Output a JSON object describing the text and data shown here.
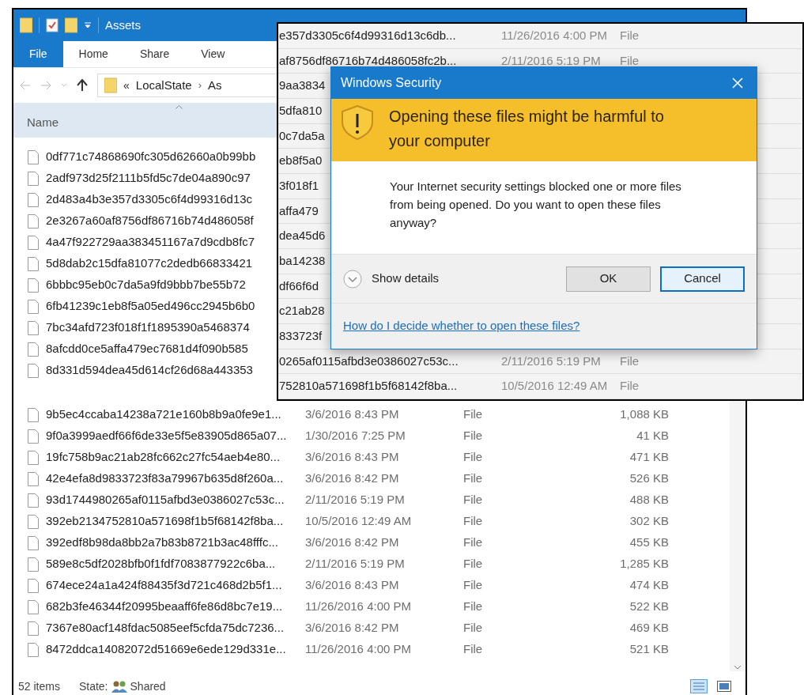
{
  "explorer": {
    "title": "Assets",
    "ribbon_tabs": [
      {
        "label": "File",
        "selected": true
      },
      {
        "label": "Home",
        "selected": false
      },
      {
        "label": "Share",
        "selected": false
      },
      {
        "label": "View",
        "selected": false
      }
    ],
    "breadcrumb": {
      "overflow": "«",
      "items": [
        "LocalState",
        "As"
      ],
      "separator": "›"
    },
    "column_header": "Name",
    "files": [
      {
        "name": "0df771c74868690fc305d62660a0b99bb"
      },
      {
        "name": "2adf973d25f2111b5fd5c7de04a890c97"
      },
      {
        "name": "2d483a4b3e357d3305c6f4d99316d13c"
      },
      {
        "name": "2e3267a60af8756df86716b74d486058f"
      },
      {
        "name": "4a47f922729aa383451167a7d9cdb8fc7"
      },
      {
        "name": "5d8dab2c15dfa81077c2dedb66833421"
      },
      {
        "name": "6bbbc95eb0c7da5a9fd9bbb7be55b72"
      },
      {
        "name": "6fb41239c1eb8f5a05ed496cc2945b6b0"
      },
      {
        "name": "7bc34afd723f018f1f1895390a5468374"
      },
      {
        "name": "8afcdd0ce5affa479ec7681d4f090b585"
      },
      {
        "name": "8d331d594dea45d614cf26d68a443353"
      },
      {
        "name": "9b5ec4ccaba14238a721e160b8b9a0fe9e1...",
        "date": "3/6/2016 8:43 PM",
        "type": "File",
        "size": "1,088 KB"
      },
      {
        "name": "9f0a3999aedf66f6de33e5f5e83905d865a07...",
        "date": "1/30/2016 7:25 PM",
        "type": "File",
        "size": "41 KB"
      },
      {
        "name": "19fc758b9ac21ab28fc662c27fc54aeb4e80...",
        "date": "3/6/2016 8:43 PM",
        "type": "File",
        "size": "471 KB"
      },
      {
        "name": "42e4efa8d9833723f83a79967b635d8f260a...",
        "date": "3/6/2016 8:42 PM",
        "type": "File",
        "size": "526 KB"
      },
      {
        "name": "93d1744980265af0115afbd3e0386027c53c...",
        "date": "2/11/2016 5:19 PM",
        "type": "File",
        "size": "488 KB"
      },
      {
        "name": "392eb2134752810a571698f1b5f68142f8ba...",
        "date": "10/5/2016 12:49 AM",
        "type": "File",
        "size": "302 KB"
      },
      {
        "name": "392edf8b98da8bb2a7b83b8721b3ac48fffc...",
        "date": "3/6/2016 8:42 PM",
        "type": "File",
        "size": "455 KB"
      },
      {
        "name": "589e8c5df2028bfb0f1fdf7083877922c6ba...",
        "date": "2/11/2016 5:19 PM",
        "type": "File",
        "size": "1,285 KB"
      },
      {
        "name": "674ece24a1a424f88435f3d721c468d2b5f1...",
        "date": "3/6/2016 8:43 PM",
        "type": "File",
        "size": "474 KB"
      },
      {
        "name": "682b3fe46344f20995beaaff6fe86d8bc7e19...",
        "date": "11/26/2016 4:00 PM",
        "type": "File",
        "size": "522 KB"
      },
      {
        "name": "7367e80acf148fdac5085eef5cfda75dc7236...",
        "date": "3/6/2016 8:42 PM",
        "type": "File",
        "size": "469 KB"
      },
      {
        "name": "8472ddca14082072d51669e6ede129d331e...",
        "date": "11/26/2016 4:00 PM",
        "type": "File",
        "size": "521 KB"
      }
    ],
    "status": {
      "count": "52 items",
      "state_label": "State:",
      "state_value": "Shared"
    }
  },
  "background_window": {
    "rows": [
      {
        "name": "e357d3305c6f4d99316d13c6db...",
        "date": "11/26/2016 4:00 PM",
        "type": "File"
      },
      {
        "name": "af8756df86716b74d486058fc2b...",
        "date": "2/11/2016 5:19 PM",
        "type": "File"
      },
      {
        "name": "9aa3834"
      },
      {
        "name": "5dfa810"
      },
      {
        "name": "0c7da5a"
      },
      {
        "name": "eb8f5a0"
      },
      {
        "name": "3f018f1"
      },
      {
        "name": "affa479"
      },
      {
        "name": "dea45d6"
      },
      {
        "name": "ba14238"
      },
      {
        "name": "df66f6d"
      },
      {
        "name": "c21ab28"
      },
      {
        "name": "833723f"
      },
      {
        "name": "0265af0115afbd3e0386027c53c...",
        "date": "2/11/2016 5:19 PM",
        "type": "File"
      },
      {
        "name": "752810a571698f1b5f68142f8ba...",
        "date": "10/5/2016 12:49 AM",
        "type": "File"
      }
    ]
  },
  "dialog": {
    "title": "Windows Security",
    "heading": "Opening these files might be harmful to your computer",
    "message": "Your Internet security settings blocked one or more files from being opened. Do you want to open these files anyway?",
    "details_label": "Show details",
    "buttons": [
      {
        "label": "OK",
        "focused": false
      },
      {
        "label": "Cancel",
        "focused": true
      }
    ],
    "link": "How do I decide whether to open these files?"
  }
}
